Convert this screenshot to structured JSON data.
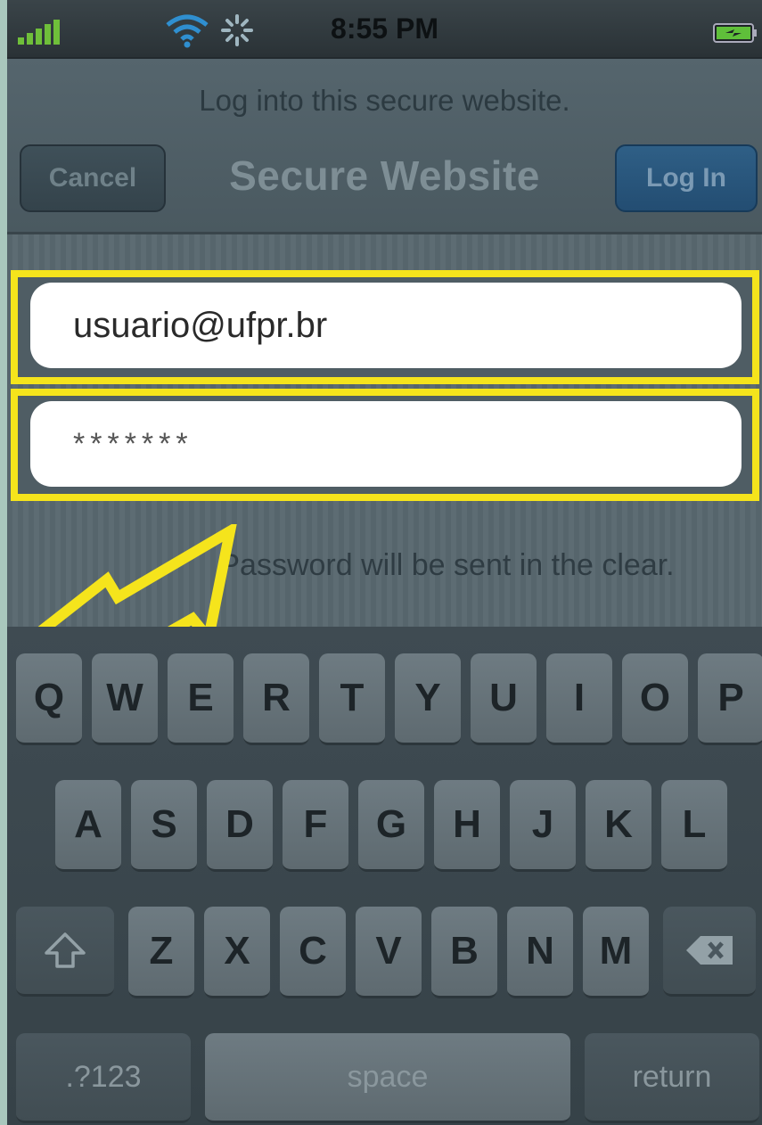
{
  "status_bar": {
    "time": "8:55 PM"
  },
  "nav": {
    "prompt": "Log into this secure website.",
    "title": "Secure Website",
    "cancel_label": "Cancel",
    "login_label": "Log In"
  },
  "form": {
    "email_value": "usuario@ufpr.br",
    "password_value": "*******",
    "warning": "Password will be sent in the clear."
  },
  "keyboard": {
    "row1": [
      "Q",
      "W",
      "E",
      "R",
      "T",
      "Y",
      "U",
      "I",
      "O",
      "P"
    ],
    "row2": [
      "A",
      "S",
      "D",
      "F",
      "G",
      "H",
      "J",
      "K",
      "L"
    ],
    "row3": [
      "Z",
      "X",
      "C",
      "V",
      "B",
      "N",
      "M"
    ],
    "numbers_label": ".?123",
    "space_label": "space",
    "return_label": "return"
  },
  "colors": {
    "highlight": "#f5e41c",
    "background": "#a9c7bd",
    "login_button": "#2f5f86"
  }
}
